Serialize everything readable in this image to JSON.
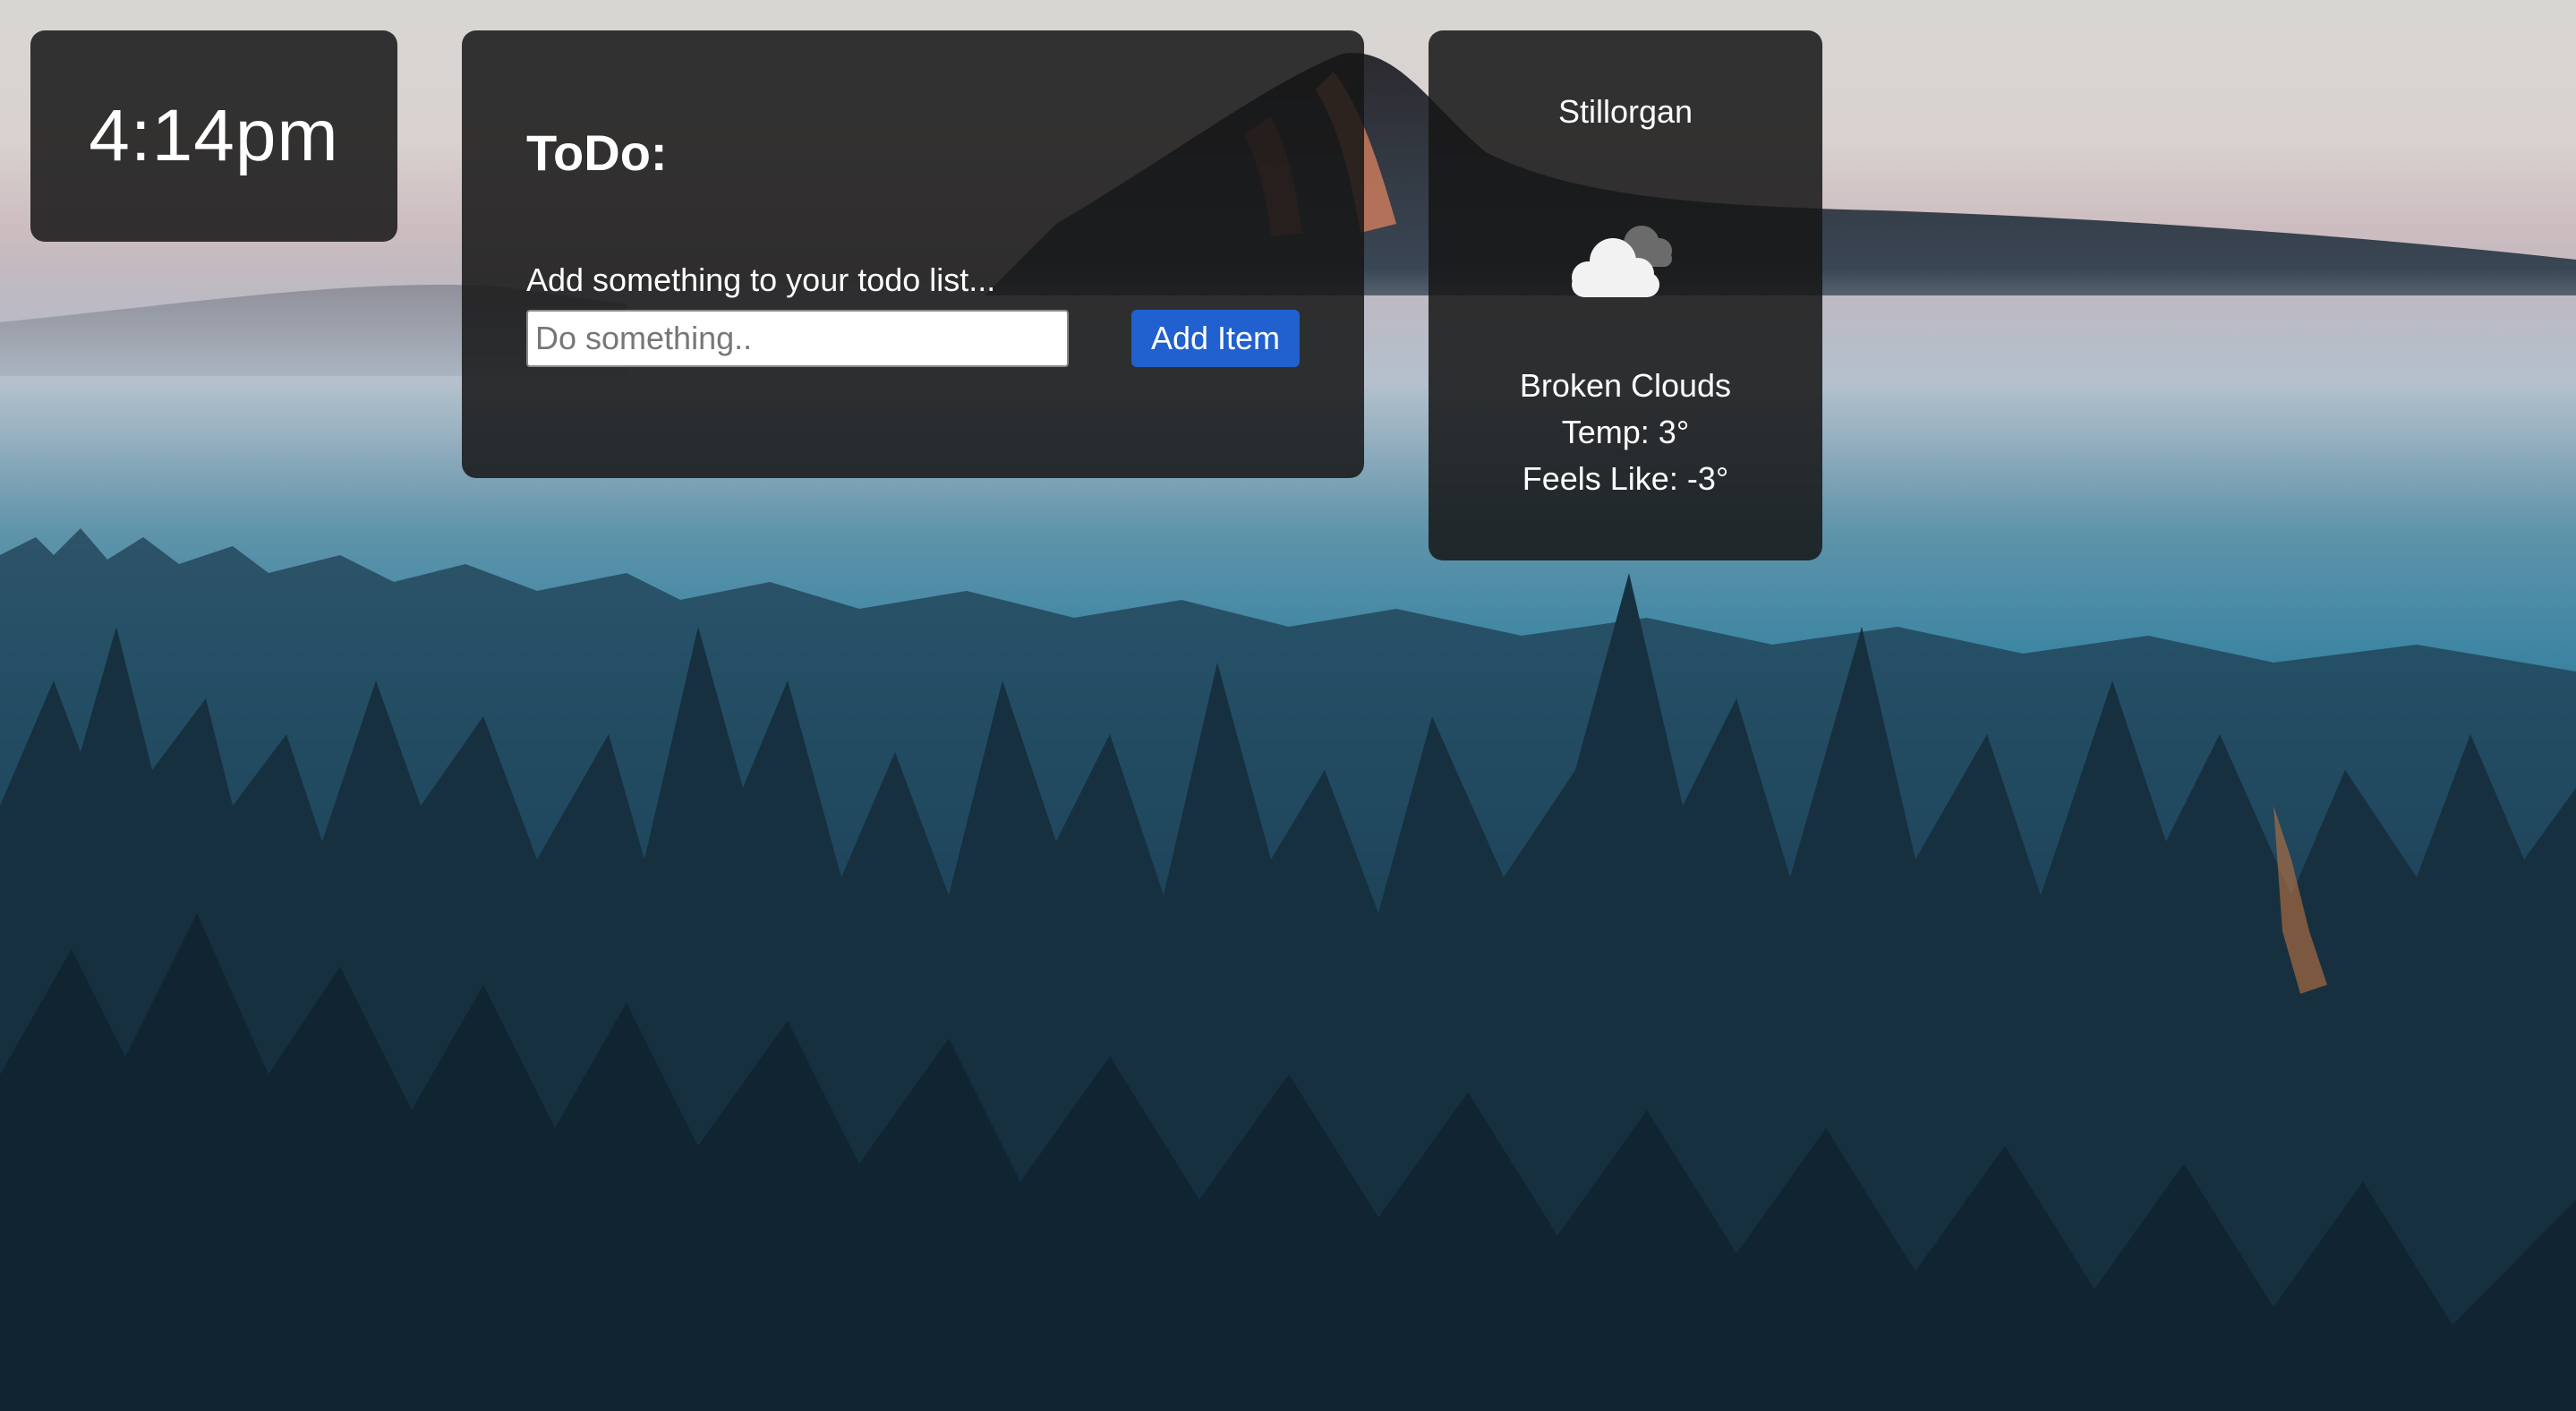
{
  "clock": {
    "time": "4:14pm"
  },
  "todo": {
    "title": "ToDo:",
    "prompt": "Add something to your todo list...",
    "input_value": "",
    "input_placeholder": "Do something..",
    "add_button_label": "Add Item"
  },
  "weather": {
    "location": "Stillorgan",
    "icon": "broken-clouds-icon",
    "description": "Broken Clouds",
    "temp": "Temp: 3°",
    "feels_like": "Feels Like: -3°"
  },
  "colors": {
    "card_background": "#161616",
    "button_accent": "#2060cf",
    "text": "#ffffff"
  }
}
